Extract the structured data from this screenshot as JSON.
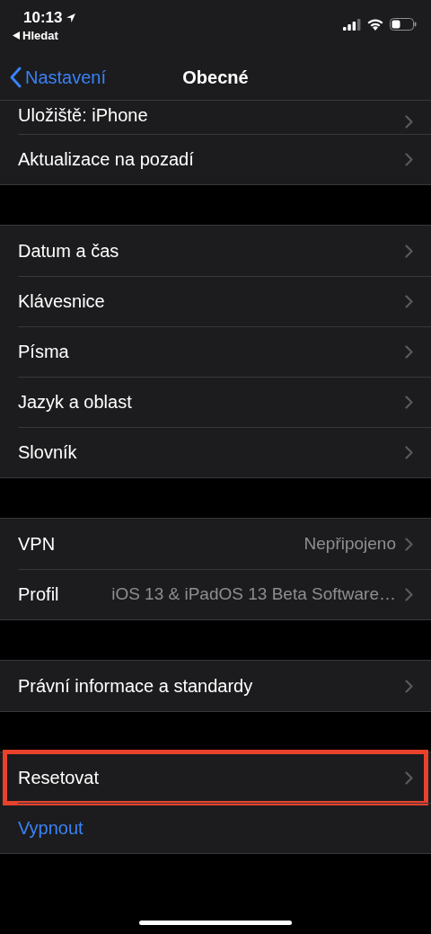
{
  "status_bar": {
    "time": "10:13",
    "back_app": "Hledat"
  },
  "nav": {
    "back": "Nastavení",
    "title": "Obecné"
  },
  "groups": [
    {
      "rows": [
        {
          "kind": "link",
          "label": "Uložiště: iPhone",
          "highlighted": false
        },
        {
          "kind": "link",
          "label": "Aktualizace na pozadí",
          "highlighted": false
        }
      ]
    },
    {
      "rows": [
        {
          "kind": "link",
          "label": "Datum a čas",
          "highlighted": false
        },
        {
          "kind": "link",
          "label": "Klávesnice",
          "highlighted": false
        },
        {
          "kind": "link",
          "label": "Písma",
          "highlighted": false
        },
        {
          "kind": "link",
          "label": "Jazyk a oblast",
          "highlighted": false
        },
        {
          "kind": "link",
          "label": "Slovník",
          "highlighted": false
        }
      ]
    },
    {
      "rows": [
        {
          "kind": "link",
          "label": "VPN",
          "value": "Nepřipojeno",
          "highlighted": false
        },
        {
          "kind": "link",
          "label": "Profil",
          "value": "iOS 13 & iPadOS 13 Beta Software…",
          "highlighted": false
        }
      ]
    },
    {
      "rows": [
        {
          "kind": "link",
          "label": "Právní informace a standardy",
          "highlighted": false
        }
      ]
    },
    {
      "rows": [
        {
          "kind": "link",
          "label": "Resetovat",
          "highlighted": true
        },
        {
          "kind": "action",
          "label": "Vypnout",
          "highlighted": false
        }
      ]
    }
  ]
}
